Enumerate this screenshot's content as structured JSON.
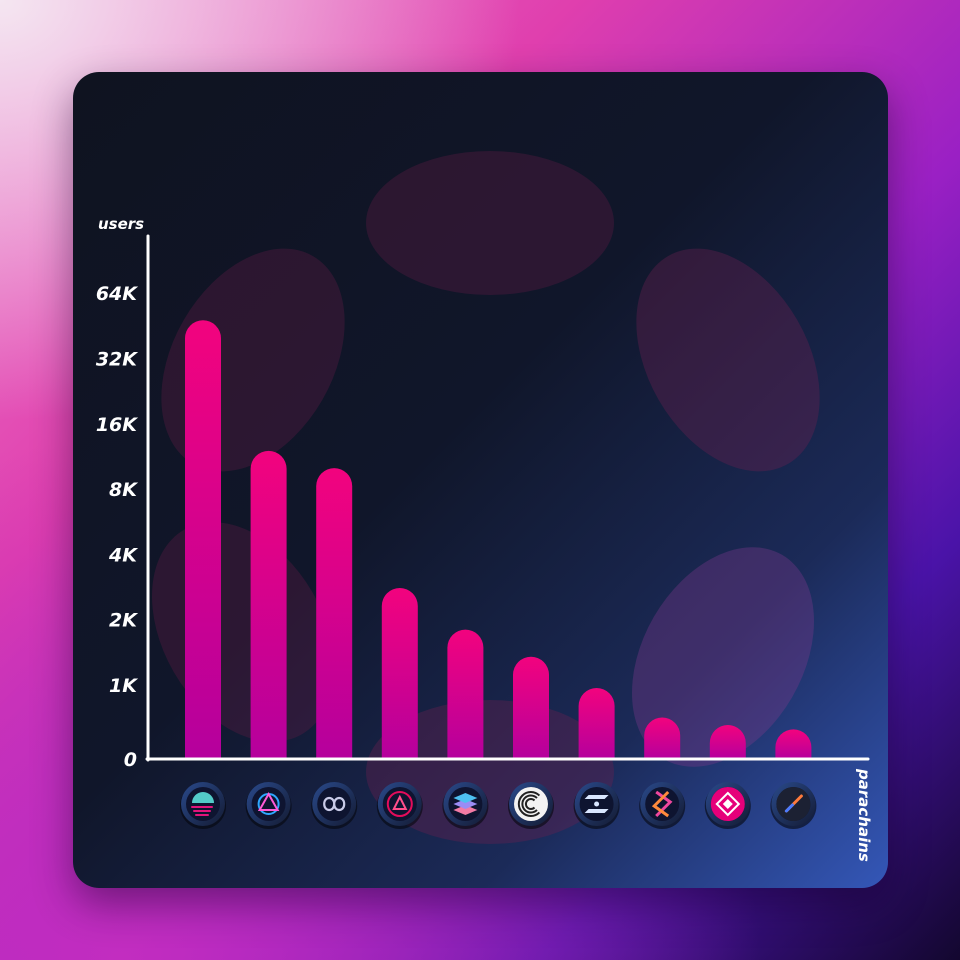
{
  "chart_data": {
    "type": "bar",
    "ylabel": "users",
    "xlabel": "parachains",
    "y_scale": "log2",
    "y_ticks": [
      {
        "label": "0",
        "value": 0
      },
      {
        "label": "1K",
        "value": 1000
      },
      {
        "label": "2K",
        "value": 2000
      },
      {
        "label": "4K",
        "value": 4000
      },
      {
        "label": "8K",
        "value": 8000
      },
      {
        "label": "16K",
        "value": 16000
      },
      {
        "label": "32K",
        "value": 32000
      },
      {
        "label": "64K",
        "value": 64000
      }
    ],
    "categories": [
      "moonbeam",
      "astar",
      "parallel",
      "acala",
      "bifrost",
      "centrifuge",
      "efinity",
      "hydradx",
      "polkadex",
      "interlay"
    ],
    "values": [
      48000,
      12000,
      10000,
      2800,
      1800,
      1350,
      960,
      560,
      460,
      400
    ],
    "colors": {
      "bar_top": "#f2037e",
      "bar_bottom": "#b5009d",
      "axis": "#ffffff",
      "decor_dot": "#5c1b44"
    }
  }
}
